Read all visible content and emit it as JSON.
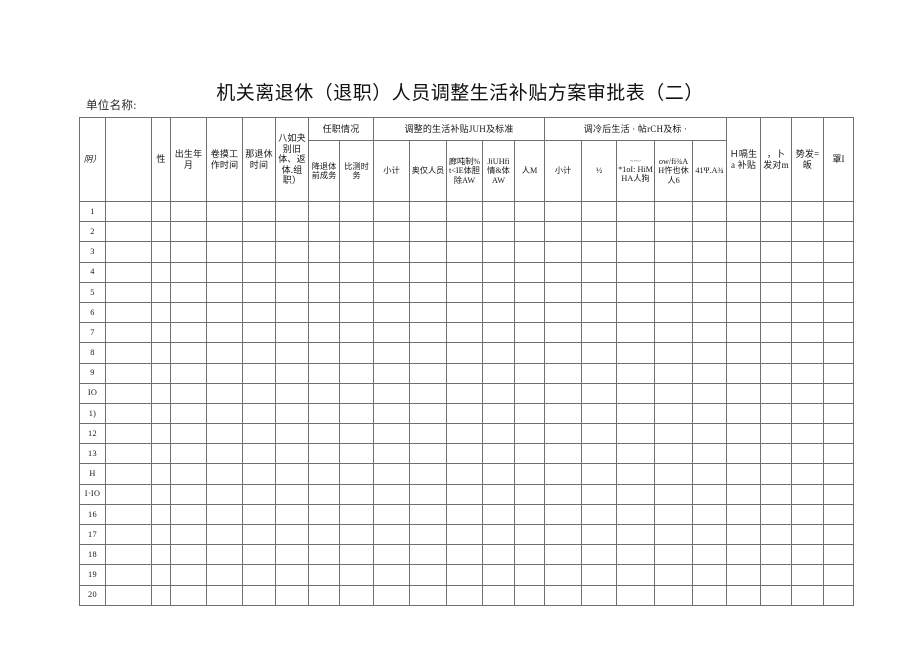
{
  "document": {
    "title": "机关离退休（退职）人员调整生活补贴方案审批表（二）",
    "unit_label": "单位名称:"
  },
  "table": {
    "group_headers": {
      "blank_1": "",
      "appointment": "任职情况",
      "adjusted_subsidy": "调整的生活补贴JUH及标准",
      "after_adjustment": "调冷后生活 · 帖rCH及标 ·",
      "blank_2": ""
    },
    "columns": [
      {
        "key": "seq",
        "label": "阴）",
        "style": "lean",
        "span_rows": 2
      },
      {
        "key": "name",
        "label": "",
        "span_rows": 2
      },
      {
        "key": "sex",
        "label": "性",
        "span_rows": 2
      },
      {
        "key": "birth",
        "label": "出生年月",
        "span_rows": 2
      },
      {
        "key": "work_start",
        "label": "卷摸工作时间",
        "span_rows": 2
      },
      {
        "key": "retire_time",
        "label": "那退休时间",
        "span_rows": 2
      },
      {
        "key": "retire_type",
        "label": "八如夬别旧体、返体.组职）",
        "span_rows": 2
      },
      {
        "key": "pre_retire_post",
        "label": "降退体前成务",
        "group": "appointment"
      },
      {
        "key": "compare_duty",
        "label": "比测时务",
        "group": "appointment"
      },
      {
        "key": "subtotal_1",
        "label": "小计",
        "group": "adjusted_subsidy"
      },
      {
        "key": "retiree_personal",
        "label": "奥仅人员",
        "group": "adjusted_subsidy"
      },
      {
        "key": "post_subsidy",
        "label": "廊吨制%t<IE体胆除AW",
        "group": "adjusted_subsidy"
      },
      {
        "key": "level_subsidy",
        "label": "JiUHfi 情&体 AW",
        "group": "adjusted_subsidy"
      },
      {
        "key": "person_m",
        "label": "人M",
        "group": "adjusted_subsidy"
      },
      {
        "key": "subtotal_2",
        "label": "小计",
        "group": "after_adjustment"
      },
      {
        "key": "half",
        "label": "½",
        "group": "after_adjustment"
      },
      {
        "key": "col_a",
        "label": "*1оI: HiMHA人狗",
        "sup": "~~~",
        "group": "after_adjustment"
      },
      {
        "key": "col_b",
        "label": "ow/fi¾A H忤也休人6",
        "group": "after_adjustment"
      },
      {
        "key": "col_c",
        "label": "41Ψ.A¾",
        "group": "after_adjustment"
      },
      {
        "key": "living_subsidy",
        "label": "Ｈ嗝生а 补贴",
        "span_rows": 2
      },
      {
        "key": "increase",
        "label": "，卜发对m",
        "span_rows": 2
      },
      {
        "key": "issue",
        "label": "势发=皈",
        "span_rows": 2
      },
      {
        "key": "remark",
        "label": "罩I",
        "span_rows": 2
      }
    ],
    "rows": [
      {
        "seq": "1"
      },
      {
        "seq": "2"
      },
      {
        "seq": "3"
      },
      {
        "seq": "4"
      },
      {
        "seq": "5"
      },
      {
        "seq": "6"
      },
      {
        "seq": "7"
      },
      {
        "seq": "8"
      },
      {
        "seq": "9"
      },
      {
        "seq": "IO"
      },
      {
        "seq": "1)"
      },
      {
        "seq": "12"
      },
      {
        "seq": "13"
      },
      {
        "seq": "H"
      },
      {
        "seq": "I·IO",
        "faded": true
      },
      {
        "seq": "16"
      },
      {
        "seq": "17"
      },
      {
        "seq": "18"
      },
      {
        "seq": "19"
      },
      {
        "seq": "20"
      }
    ]
  }
}
